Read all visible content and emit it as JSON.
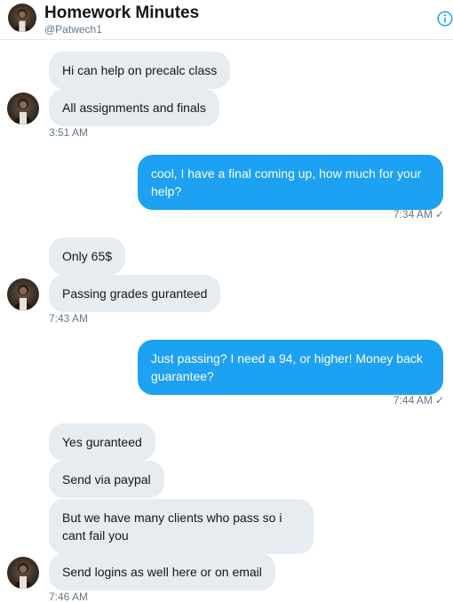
{
  "header": {
    "name": "Homework Minutes",
    "handle": "@Patwech1"
  },
  "messages": [
    {
      "text": "Hi can help on precalc class"
    },
    {
      "text": "All assignments and finals"
    },
    {
      "time": "3:51 AM"
    },
    {
      "text": "cool, I have a final coming up, how much for your help?"
    },
    {
      "time": "7:34 AM",
      "status": "✓"
    },
    {
      "text": "Only 65$"
    },
    {
      "text": "Passing grades guranteed"
    },
    {
      "time": "7:43 AM"
    },
    {
      "text": "Just passing? I need a 94, or higher! Money back guarantee?"
    },
    {
      "time": "7:44 AM",
      "status": "✓"
    },
    {
      "text": "Yes guranteed"
    },
    {
      "text": "Send via paypal"
    },
    {
      "text": "But we have many clients who pass so i cant fail you"
    },
    {
      "text": "Send logins as well here or on email"
    },
    {
      "time": "7:46 AM"
    }
  ],
  "colors": {
    "outgoing_bubble": "#1da1f2",
    "incoming_bubble": "#e6ecf0",
    "info_icon": "#1da1f2"
  },
  "icons": {
    "info": "info-icon",
    "avatar": "avatar"
  }
}
